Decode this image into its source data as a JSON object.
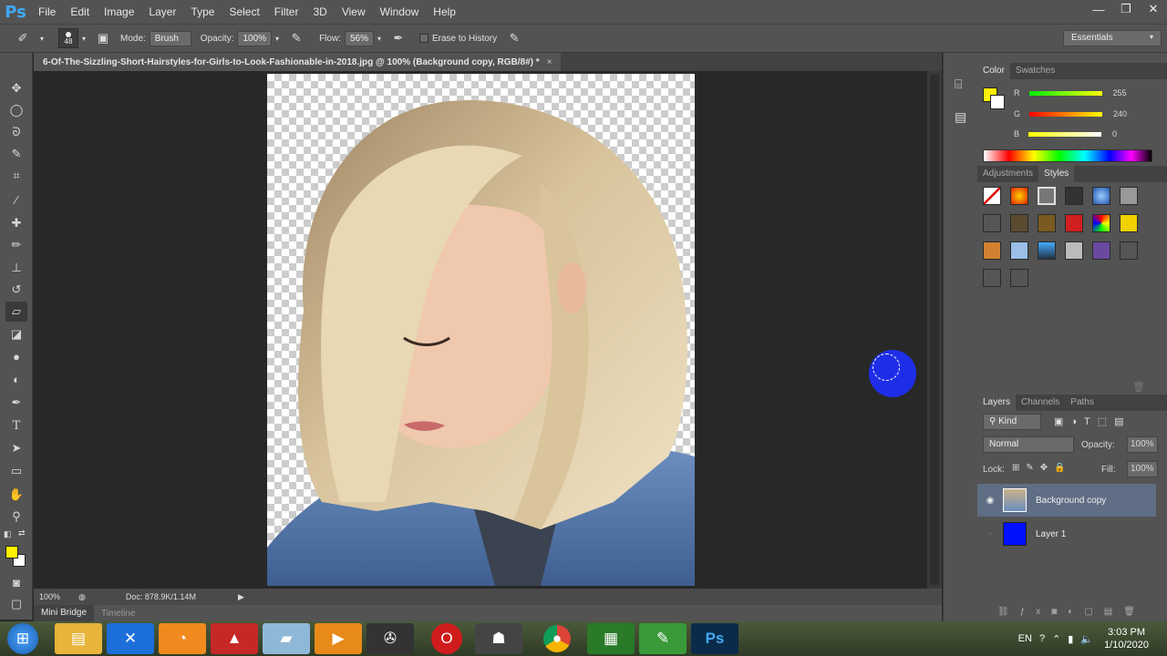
{
  "app": {
    "logo": "Ps"
  },
  "menu": [
    "File",
    "Edit",
    "Image",
    "Layer",
    "Type",
    "Select",
    "Filter",
    "3D",
    "View",
    "Window",
    "Help"
  ],
  "window_controls": {
    "minimize": "—",
    "restore": "❐",
    "close": "✕"
  },
  "options": {
    "brush_size": "48",
    "mode_label": "Mode:",
    "mode_value": "Brush",
    "opacity_label": "Opacity:",
    "opacity_value": "100%",
    "flow_label": "Flow:",
    "flow_value": "56%",
    "erase_history_label": "Erase to History",
    "workspace": "Essentials"
  },
  "document": {
    "tab_title": "6-Of-The-Sizzling-Short-Hairstyles-for-Girls-to-Look-Fashionable-in-2018.jpg @ 100% (Background copy, RGB/8#) *",
    "close": "×",
    "zoom": "100%",
    "doc_size": "Doc: 878.9K/1.14M"
  },
  "bottom_tabs": [
    "Mini Bridge",
    "Timeline"
  ],
  "color_panel": {
    "tabs": [
      "Color",
      "Swatches"
    ],
    "r_label": "R",
    "r_value": "255",
    "g_label": "G",
    "g_value": "240",
    "b_label": "B",
    "b_value": "0",
    "foreground": "#fff200"
  },
  "styles_panel": {
    "tabs": [
      "Adjustments",
      "Styles"
    ]
  },
  "layers_panel": {
    "tabs": [
      "Layers",
      "Channels",
      "Paths"
    ],
    "kind_label": "Kind",
    "blend_mode": "Normal",
    "opacity_label": "Opacity:",
    "opacity_value": "100%",
    "lock_label": "Lock:",
    "fill_label": "Fill:",
    "fill_value": "100%",
    "layers": [
      {
        "name": "Background copy",
        "visible": true,
        "selected": true
      },
      {
        "name": "Layer 1",
        "visible": false,
        "selected": false
      }
    ]
  },
  "taskbar": {
    "language": "EN",
    "time": "3:03 PM",
    "date": "1/10/2020"
  }
}
